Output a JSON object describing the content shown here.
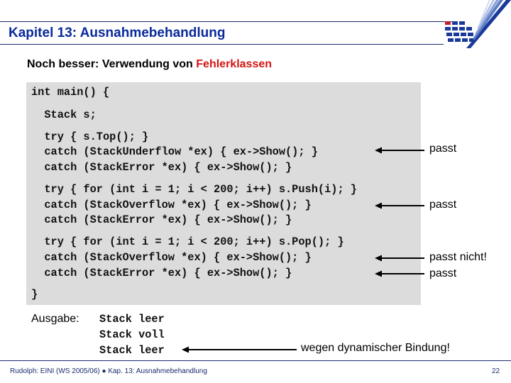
{
  "header": {
    "title": "Kapitel 13: Ausnahmebehandlung",
    "logo": "university-logo-icon"
  },
  "slide": {
    "subtitle_prefix": "Noch besser: Verwendung von ",
    "subtitle_highlight": "Fehlerklassen",
    "highlight_color": "#d41414",
    "code_lines": {
      "l0": "int main() {",
      "l1": "  Stack s;",
      "l2": "  try { s.Top(); }",
      "l3": "  catch (StackUnderflow *ex) { ex->Show(); }",
      "l4": "  catch (StackError *ex) { ex->Show(); }",
      "l5": "  try { for (int i = 1; i < 200; i++) s.Push(i); }",
      "l6": "  catch (StackOverflow *ex) { ex->Show(); }",
      "l7": "  catch (StackError *ex) { ex->Show(); }",
      "l8": "  try { for (int i = 1; i < 200; i++) s.Pop(); }",
      "l9": "  catch (StackOverflow *ex) { ex->Show(); }",
      "l10": "  catch (StackError *ex) { ex->Show(); }",
      "l11": "}"
    },
    "annotations": {
      "a1": "passt",
      "a2": "passt",
      "a3": "passt nicht!",
      "a4": "passt"
    },
    "output_label": "Ausgabe:",
    "output_lines": {
      "o1": "Stack leer",
      "o2": "Stack voll",
      "o3": "Stack leer"
    },
    "output_note": "wegen dynamischer Bindung!"
  },
  "footer": {
    "left": "Rudolph: EINI (WS 2005/06)  ●  Kap. 13: Ausnahmebehandlung",
    "page_number": "22"
  }
}
